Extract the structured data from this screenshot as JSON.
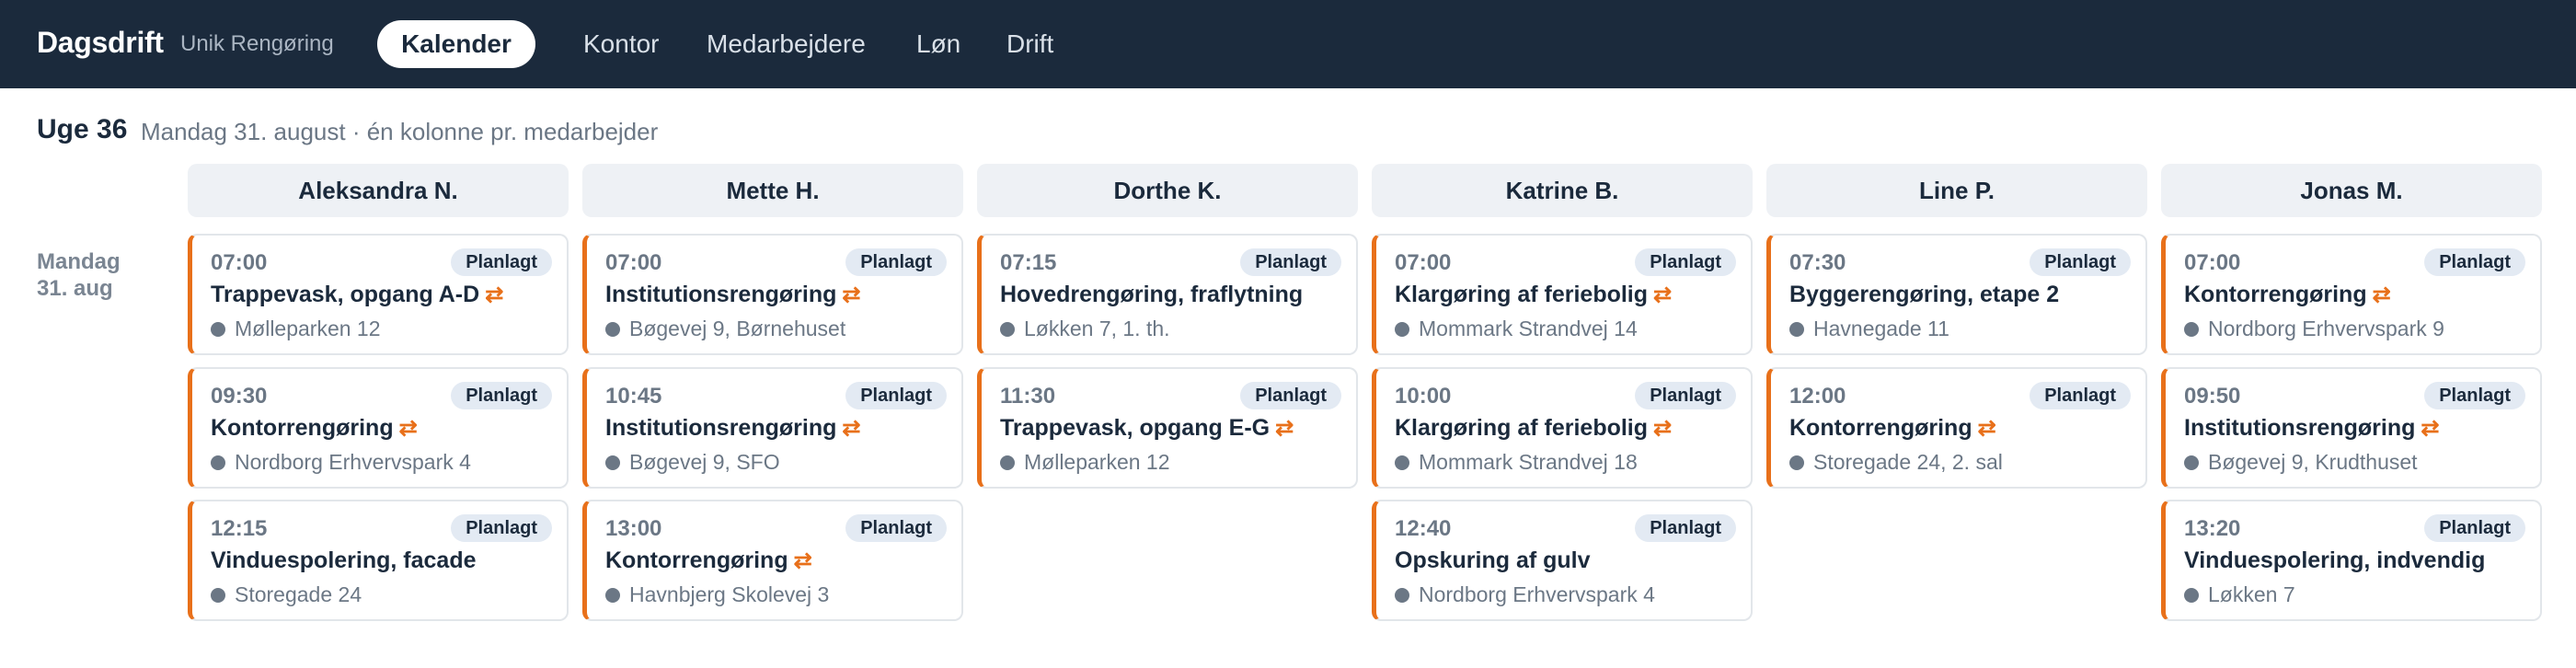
{
  "app": {
    "name": "Dagsdrift",
    "subtitle": "Unik Rengøring"
  },
  "nav": [
    {
      "label": "Kalender",
      "active": true
    },
    {
      "label": "Kontor",
      "active": false
    },
    {
      "label": "Medarbejdere",
      "active": false
    },
    {
      "label": "Løn",
      "active": false
    },
    {
      "label": "Drift",
      "active": false
    }
  ],
  "week": {
    "title": "Uge 36",
    "subtitle": "Mandag 31. august · én kolonne pr. medarbejder"
  },
  "day": {
    "name": "Mandag",
    "date": "31. aug"
  },
  "recurring_icon": "repeat-icon",
  "accent_color": "#e8701a",
  "columns": [
    {
      "name": "Aleksandra N.",
      "tasks": [
        {
          "time": "07:00",
          "status": "Planlagt",
          "title": "Trappevask, opgang A-D",
          "recurring": true,
          "address": "Mølleparken 12"
        },
        {
          "time": "09:30",
          "status": "Planlagt",
          "title": "Kontorrengøring",
          "recurring": true,
          "address": "Nordborg Erhvervspark 4"
        },
        {
          "time": "12:15",
          "status": "Planlagt",
          "title": "Vinduespolering, facade",
          "recurring": false,
          "address": "Storegade 24"
        }
      ]
    },
    {
      "name": "Mette H.",
      "tasks": [
        {
          "time": "07:00",
          "status": "Planlagt",
          "title": "Institutionsrengøring",
          "recurring": true,
          "address": "Bøgevej 9, Børnehuset"
        },
        {
          "time": "10:45",
          "status": "Planlagt",
          "title": "Institutionsrengøring",
          "recurring": true,
          "address": "Bøgevej 9, SFO"
        },
        {
          "time": "13:00",
          "status": "Planlagt",
          "title": "Kontorrengøring",
          "recurring": true,
          "address": "Havnbjerg Skolevej 3"
        }
      ]
    },
    {
      "name": "Dorthe K.",
      "tasks": [
        {
          "time": "07:15",
          "status": "Planlagt",
          "title": "Hovedrengøring, fraflytning",
          "recurring": false,
          "address": "Løkken 7, 1. th."
        },
        {
          "time": "11:30",
          "status": "Planlagt",
          "title": "Trappevask, opgang E-G",
          "recurring": true,
          "address": "Mølleparken 12"
        }
      ]
    },
    {
      "name": "Katrine B.",
      "tasks": [
        {
          "time": "07:00",
          "status": "Planlagt",
          "title": "Klargøring af feriebolig",
          "recurring": true,
          "address": "Mommark Strandvej 14"
        },
        {
          "time": "10:00",
          "status": "Planlagt",
          "title": "Klargøring af feriebolig",
          "recurring": true,
          "address": "Mommark Strandvej 18"
        },
        {
          "time": "12:40",
          "status": "Planlagt",
          "title": "Opskuring af gulv",
          "recurring": false,
          "address": "Nordborg Erhvervspark 4"
        }
      ]
    },
    {
      "name": "Line P.",
      "tasks": [
        {
          "time": "07:30",
          "status": "Planlagt",
          "title": "Byggerengøring, etape 2",
          "recurring": false,
          "address": "Havnegade 11"
        },
        {
          "time": "12:00",
          "status": "Planlagt",
          "title": "Kontorrengøring",
          "recurring": true,
          "address": "Storegade 24, 2. sal"
        }
      ]
    },
    {
      "name": "Jonas M.",
      "tasks": [
        {
          "time": "07:00",
          "status": "Planlagt",
          "title": "Kontorrengøring",
          "recurring": true,
          "address": "Nordborg Erhvervspark 9"
        },
        {
          "time": "09:50",
          "status": "Planlagt",
          "title": "Institutionsrengøring",
          "recurring": true,
          "address": "Bøgevej 9, Krudthuset"
        },
        {
          "time": "13:20",
          "status": "Planlagt",
          "title": "Vinduespolering, indvendig",
          "recurring": false,
          "address": "Løkken 7"
        }
      ]
    }
  ]
}
